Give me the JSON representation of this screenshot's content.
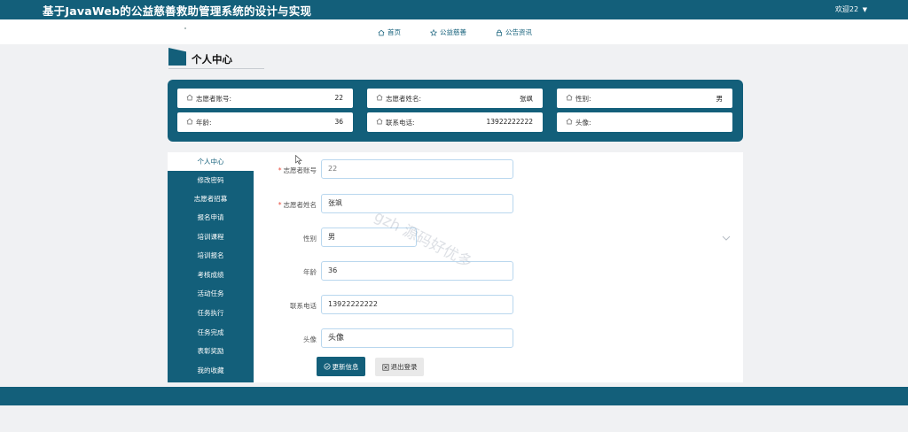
{
  "header": {
    "title": "基于JavaWeb的公益慈善救助管理系统的设计与实现",
    "welcome": "欢迎22",
    "welcome_caret": "▼"
  },
  "nav": {
    "items": [
      {
        "label": "首页",
        "icon": "home-icon"
      },
      {
        "label": "公益慈善",
        "icon": "star-icon"
      },
      {
        "label": "公告资讯",
        "icon": "lock-icon"
      }
    ]
  },
  "section_title": "个人中心",
  "info": {
    "account": {
      "label": "志愿者账号:",
      "value": "22"
    },
    "name": {
      "label": "志愿者姓名:",
      "value": "张飒"
    },
    "gender": {
      "label": "性别:",
      "value": "男"
    },
    "age": {
      "label": "年龄:",
      "value": "36"
    },
    "phone": {
      "label": "联系电话:",
      "value": "13922222222"
    },
    "avatar": {
      "label": "头像:",
      "value": ""
    }
  },
  "sidebar": {
    "items": [
      "个人中心",
      "修改密码",
      "志愿者招募",
      "报名申请",
      "培训课程",
      "培训报名",
      "考核成绩",
      "活动任务",
      "任务执行",
      "任务完成",
      "表彰奖励",
      "我的收藏"
    ],
    "active_index": 0
  },
  "form": {
    "account": {
      "label": "志愿者账号",
      "value": "22"
    },
    "name": {
      "label": "志愿者姓名",
      "value": "张飒"
    },
    "gender": {
      "label": "性别",
      "value": "男"
    },
    "age": {
      "label": "年龄",
      "value": "36"
    },
    "phone": {
      "label": "联系电话",
      "value": "13922222222"
    },
    "avatar": {
      "label": "头像",
      "value": "头像"
    }
  },
  "buttons": {
    "update": "更新信息",
    "logout": "退出登录"
  },
  "watermark": "gzh 源码好优多",
  "colors": {
    "primary": "#135f7a",
    "page_bg": "#f0f1f3",
    "input_border": "#b9d7ee",
    "required": "#e74c3c"
  }
}
